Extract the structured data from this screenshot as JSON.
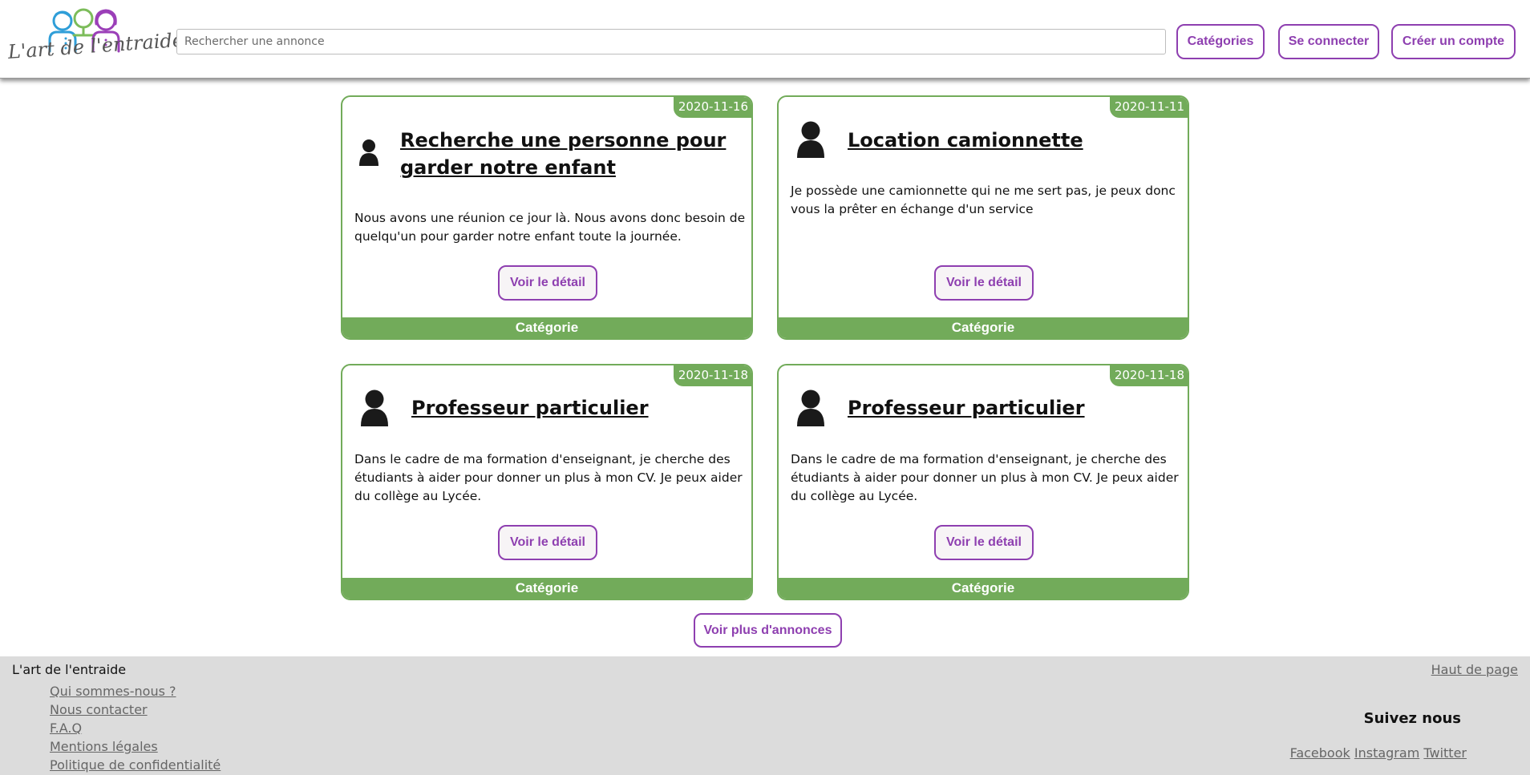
{
  "header": {
    "logo_text": "L'art de l'entraide",
    "search_placeholder": "Rechercher une annonce",
    "categories_label": "Catégories",
    "login_label": "Se connecter",
    "signup_label": "Créer un compte"
  },
  "cards": [
    {
      "date": "2020-11-16",
      "title": "Recherche une personne pour garder notre enfant",
      "description": "Nous avons une réunion ce jour là. Nous avons donc besoin de quelqu'un pour garder notre enfant toute la journée.",
      "button_label": "Voir le détail",
      "category": "Catégorie"
    },
    {
      "date": "2020-11-11",
      "title": "Location camionnette",
      "description": "Je possède une camionnette qui ne me sert pas, je peux donc vous la prêter en échange d'un service",
      "button_label": "Voir le détail",
      "category": "Catégorie"
    },
    {
      "date": "2020-11-18",
      "title": "Professeur particulier",
      "description": "Dans le cadre de ma formation d'enseignant, je cherche des étudiants à aider pour donner un plus à mon CV. Je peux aider du collège au Lycée.",
      "button_label": "Voir le détail",
      "category": "Catégorie"
    },
    {
      "date": "2020-11-18",
      "title": "Professeur particulier",
      "description": "Dans le cadre de ma formation d'enseignant, je cherche des étudiants à aider pour donner un plus à mon CV. Je peux aider du collège au Lycée.",
      "button_label": "Voir le détail",
      "category": "Catégorie"
    }
  ],
  "more_label": "Voir plus d'annonces",
  "footer": {
    "brand": "L'art de l'entraide",
    "links": [
      "Qui sommes-nous ?",
      "Nous contacter",
      "F.A.Q",
      "Mentions légales",
      "Politique de confidentialité"
    ],
    "top_label": "Haut de page",
    "follow_label": "Suivez nous",
    "socials": [
      "Facebook",
      "Instagram",
      "Twitter"
    ]
  },
  "colors": {
    "accent_purple": "#8e3fb0",
    "card_green": "#72ab5a",
    "logo_blue": "#2f9ed8",
    "footer_bg": "#dcdcdc"
  }
}
